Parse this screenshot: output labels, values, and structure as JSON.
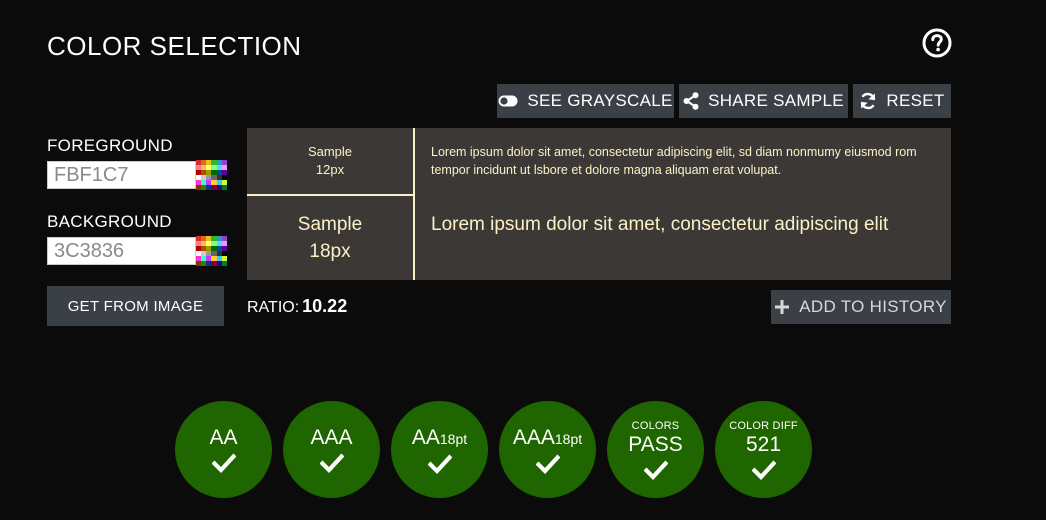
{
  "header": {
    "title": "COLOR SELECTION",
    "help_icon": "question-circle-icon"
  },
  "toolbar": {
    "grayscale_label": "SEE GRAYSCALE",
    "share_label": "SHARE SAMPLE",
    "reset_label": "RESET"
  },
  "foreground": {
    "label": "FOREGROUND",
    "value": "FBF1C7",
    "color": "#fbf1c7"
  },
  "background": {
    "label": "BACKGROUND",
    "value": "3C3836",
    "color": "#3c3836"
  },
  "get_from_image_label": "GET FROM IMAGE",
  "sample": {
    "small_label_line1": "Sample",
    "small_label_line2": "12px",
    "large_label_line1": "Sample",
    "large_label_line2": "18px",
    "small_text": "Lorem ipsum dolor sit amet, consectetur adipiscing elit, sd diam nonmumy eiusmod rom tempor incidunt ut lsbore et dolore magna aliquam erat volupat.",
    "large_text": "Lorem ipsum dolor sit amet, consectetur adipiscing elit"
  },
  "ratio": {
    "label": "RATIO:",
    "value": "10.22"
  },
  "add_history_label": "ADD TO HISTORY",
  "results": [
    {
      "top": "",
      "main": "AA",
      "sub": ""
    },
    {
      "top": "",
      "main": "AAA",
      "sub": ""
    },
    {
      "top": "",
      "main": "AA",
      "sub": "18pt"
    },
    {
      "top": "",
      "main": "AAA",
      "sub": "18pt"
    },
    {
      "top": "COLORS",
      "main": "PASS",
      "sub": ""
    },
    {
      "top": "COLOR DIFF",
      "main": "521",
      "sub": ""
    }
  ],
  "colors": {
    "button_bg": "#3b3f46",
    "pass_green": "#1f6600",
    "page_bg": "#0b0b0b"
  }
}
